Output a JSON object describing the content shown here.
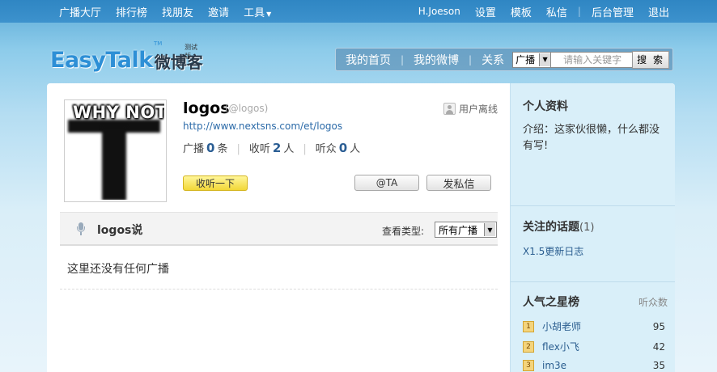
{
  "topnav": {
    "left": [
      "广播大厅",
      "排行榜",
      "找朋友",
      "邀请",
      "工具"
    ],
    "right": [
      "H.Joeson",
      "设置",
      "模板",
      "私信",
      "后台管理",
      "退出"
    ]
  },
  "logo": {
    "text": "EasyTalk",
    "cn": "微博客",
    "badge": "测试版",
    "tm": "TM"
  },
  "header_menu": {
    "links": [
      "我的首页",
      "我的微博",
      "关系"
    ],
    "search_scope": "广播",
    "search_placeholder": "请输入关键字",
    "search_button": "搜 索"
  },
  "profile": {
    "avatar_text": "WHY NOT",
    "name": "logos",
    "handle": "(@logos)",
    "status": "用户离线",
    "url": "http://www.nextsns.com/et/logos",
    "stats": {
      "broadcast_label": "广播",
      "broadcast_value": "0",
      "broadcast_unit": "条",
      "following_label": "收听",
      "following_value": "2",
      "following_unit": "人",
      "followers_label": "听众",
      "followers_value": "0",
      "followers_unit": "人"
    },
    "follow_button": "收听一下",
    "at_button": "@TA",
    "message_button": "发私信"
  },
  "feed": {
    "title": "logos说",
    "view_label": "查看类型:",
    "view_value": "所有广播",
    "empty_text": "这里还没有任何广播"
  },
  "sidebar": {
    "profile_title": "个人资料",
    "intro": "介绍：这家伙很懒，什么都没有写!",
    "topics_title": "关注的话题",
    "topics_count": "(1)",
    "topic": "X1.5更新日志",
    "stars_title": "人气之星榜",
    "stars_sub": "听众数",
    "stars": [
      {
        "rank": "1",
        "name": "小胡老师",
        "value": "95"
      },
      {
        "rank": "2",
        "name": "flex小飞",
        "value": "42"
      },
      {
        "rank": "3",
        "name": "im3e",
        "value": "35"
      }
    ]
  }
}
